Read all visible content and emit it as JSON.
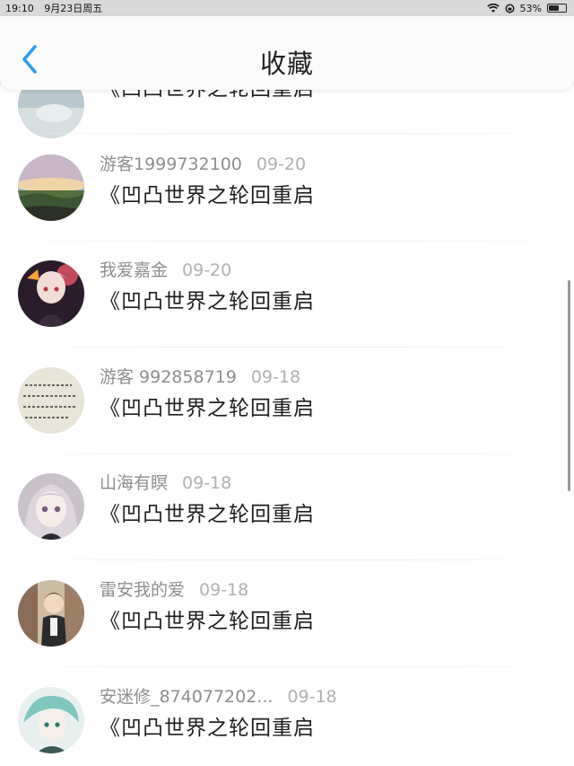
{
  "status_bar": {
    "time": "19:10",
    "date": "9月23日周五",
    "battery": "53%"
  },
  "header": {
    "title": "收藏"
  },
  "items": [
    {
      "user": "",
      "date": "",
      "title": "《凹凸世界之轮回重启"
    },
    {
      "user": "游客1999732100",
      "date": "09-20",
      "title": "《凹凸世界之轮回重启"
    },
    {
      "user": "我爱嘉金",
      "date": "09-20",
      "title": "《凹凸世界之轮回重启"
    },
    {
      "user": "游客 992858719",
      "date": "09-18",
      "title": "《凹凸世界之轮回重启"
    },
    {
      "user": "山海有瞑",
      "date": "09-18",
      "title": "《凹凸世界之轮回重启"
    },
    {
      "user": "雷安我的爱",
      "date": "09-18",
      "title": "《凹凸世界之轮回重启"
    },
    {
      "user": "安迷修_874077202...",
      "date": "09-18",
      "title": "《凹凸世界之轮回重启"
    }
  ],
  "colors": {
    "accent": "#2f9bf0",
    "text": "#1e1e1e",
    "meta": "#8e8e8e"
  }
}
